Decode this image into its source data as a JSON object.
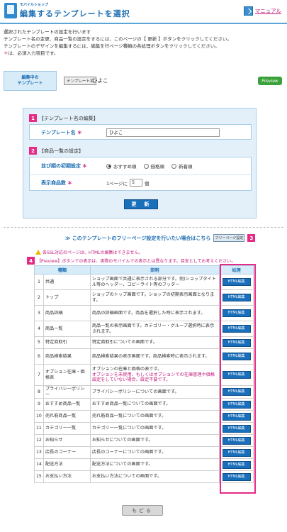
{
  "header": {
    "small_label": "モバイルショップ",
    "title": "編集するテンプレートを選択",
    "manual_label": "マニュアル"
  },
  "intro": {
    "line1": "選択されたテンプレートの設定を行います",
    "line2": "テンプレート名の変更、商品一覧の設定をするには、このページの【 更新 】ボタンをクリックしてください。",
    "line3": "テンプレートのデザインを編集するには、編集を行ページ種類の各処理ボタンをクリックしてください。",
    "line4_mark": "＊",
    "line4_text": "は、必須入力項目です。"
  },
  "current": {
    "label_line1": "編集中の",
    "label_line2": "テンプレート",
    "badge": "テンプレート名",
    "value": "ひよこ",
    "preview_label": "Preview"
  },
  "section1": {
    "number": "1",
    "title": "【テンプレート名の編集】",
    "field_label": "テンプレート名",
    "field_value": "ひよこ"
  },
  "section2": {
    "number": "2",
    "title": "【商品一覧の設定】",
    "sort_label": "並び順の初期設定",
    "sort_options": [
      "おすすめ順",
      "価格順",
      "新着順"
    ],
    "count_label": "表示商品数",
    "count_prefix": "1ページに",
    "count_value": "5",
    "count_suffix": "個"
  },
  "update_label": "更　新",
  "freepage": {
    "text": "≫ このテンプレートのフリーページ設定を行いたい場合はこちら",
    "button": "フリーページ設定",
    "number": "3"
  },
  "notice_ssl": "各SSL対応のページは、HTMLの編集はできません。",
  "notice_preview": {
    "number": "4",
    "text": "【Preview】ボタンでの表示は、実際のモバイルでの表示とは異なります。目安としてお考えください。"
  },
  "star": "＊",
  "table": {
    "headers": [
      "種類",
      "説明",
      "処理"
    ],
    "rows": [
      {
        "no": "1",
        "type": "共通",
        "desc": "ショップ画面で共通に表示される部分です。例)ショップタイトル等のヘッダー、コピーライト等のフッター",
        "btn": "HTML編集"
      },
      {
        "no": "2",
        "type": "トップ",
        "desc": "ショップのトップ画面です。ショップの初期表示画面となります。",
        "btn": "HTML編集"
      },
      {
        "no": "3",
        "type": "商品詳細",
        "desc": "商品の詳細画面です。商品を選択した時に表示されます。",
        "btn": "HTML編集"
      },
      {
        "no": "4",
        "type": "商品一覧",
        "desc": "商品一覧の表示画面です。カテゴリー・グループ選択時に表示されます。",
        "btn": "HTML編集"
      },
      {
        "no": "5",
        "type": "特定商取引",
        "desc": "特定商取引についての画面です。",
        "btn": "HTML編集"
      },
      {
        "no": "6",
        "type": "商品検索結果",
        "desc": "商品検索結果の表示画面です。商品検索時に表示されます。",
        "btn": "HTML編集"
      },
      {
        "no": "7",
        "type": "オプション在庫・価格表",
        "desc": "オプションの在庫と価格の表です。",
        "desc_warn": "オプションを未使用、もしくはオプションでの在庫管理や価格設定をしていない場合、設定不要です。",
        "btn": "HTML編集"
      },
      {
        "no": "8",
        "type": "プライバシーポリシー",
        "desc": "プライバシーポリシーについての画面です。",
        "btn": "HTML編集"
      },
      {
        "no": "9",
        "type": "おすすめ商品一覧",
        "desc": "おすすめ商品一覧についての画面です。",
        "btn": "HTML編集"
      },
      {
        "no": "10",
        "type": "売れ筋商品一覧",
        "desc": "売れ筋商品一覧についての画面です。",
        "btn": "HTML編集"
      },
      {
        "no": "11",
        "type": "カテゴリー一覧",
        "desc": "カテゴリー一覧についての画面です。",
        "btn": "HTML編集"
      },
      {
        "no": "12",
        "type": "お知らせ",
        "desc": "お知らせについての画面です。",
        "btn": "HTML編集"
      },
      {
        "no": "13",
        "type": "店長のコーナー",
        "desc": "店長のコーナーについての画面です。",
        "btn": "HTML編集"
      },
      {
        "no": "14",
        "type": "配送方法",
        "desc": "配送方法についての画面です。",
        "btn": "HTML編集"
      },
      {
        "no": "15",
        "type": "お支払い方法",
        "desc": "お支払い方法についての画面です。",
        "btn": "HTML編集"
      }
    ]
  },
  "back_label": "もどる",
  "colors": {
    "accent_blue": "#1f6fb3",
    "button_blue": "#1a6fba",
    "highlight_pink": "#e62b86",
    "panel_bg": "#e3f0f9"
  }
}
